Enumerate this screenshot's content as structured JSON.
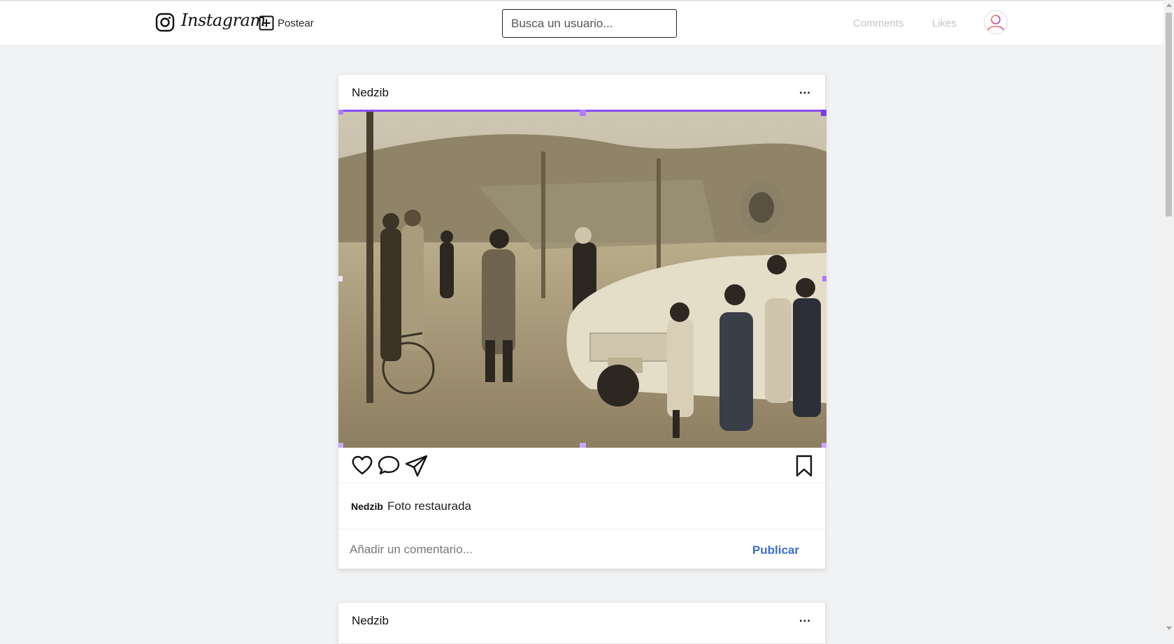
{
  "header": {
    "brand": "Instagram",
    "post_label": "Postear",
    "search_placeholder": "Busca un usuario...",
    "nav": {
      "comments": "Comments",
      "likes": "Likes"
    }
  },
  "posts": [
    {
      "user": "Nedzib",
      "more": "...",
      "caption_user": "Nedzib",
      "caption_text": "Foto restaurada",
      "comment_placeholder": "Añadir un comentario...",
      "publish_label": "Publicar"
    },
    {
      "user": "Nedzib",
      "more": "..."
    }
  ],
  "colors": {
    "background": "#f1f2f3",
    "accent_link": "#3b6fd0",
    "selection_outline": "#8a4dff"
  },
  "icons": [
    "instagram-logo-icon",
    "plus-square-icon",
    "heart-icon",
    "comment-icon",
    "share-icon",
    "bookmark-icon",
    "avatar-icon"
  ]
}
